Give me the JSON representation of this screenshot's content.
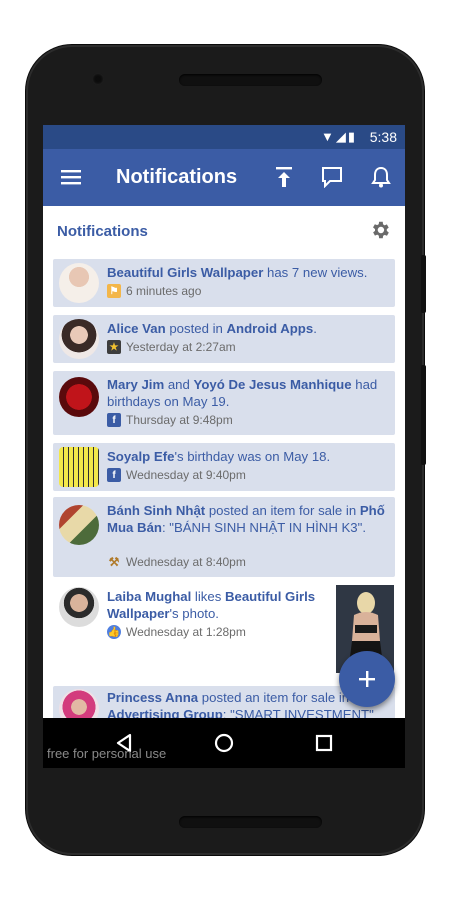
{
  "status_bar": {
    "time": "5:38",
    "wifi_icon": "wifi-icon",
    "signal_icon": "signal-icon",
    "battery_icon": "battery-icon"
  },
  "app_bar": {
    "title": "Notifications",
    "menu_icon": "hamburger-menu-icon",
    "actions": [
      "scroll-top-icon",
      "chat-icon",
      "bell-icon"
    ]
  },
  "section": {
    "title": "Notifications",
    "settings_icon": "gear-icon"
  },
  "notifications": [
    {
      "parts": [
        {
          "t": "Beautiful Girls Wallpaper",
          "b": true
        },
        {
          "t": " has 7 new views.",
          "b": false
        }
      ],
      "icon": "flag-icon",
      "time": "6 minutes ago",
      "unread": true
    },
    {
      "parts": [
        {
          "t": "Alice Van",
          "b": true
        },
        {
          "t": " posted in ",
          "b": false
        },
        {
          "t": "Android Apps",
          "b": true
        },
        {
          "t": ".",
          "b": false
        }
      ],
      "icon": "star-icon",
      "time": "Yesterday at 2:27am",
      "unread": true
    },
    {
      "parts": [
        {
          "t": "Mary Jim",
          "b": true
        },
        {
          "t": " and ",
          "b": false
        },
        {
          "t": "Yoyó De Jesus Manhique",
          "b": true
        },
        {
          "t": " had birthdays on May 19.",
          "b": false
        }
      ],
      "icon": "facebook-icon",
      "time": "Thursday at 9:48pm",
      "unread": true
    },
    {
      "parts": [
        {
          "t": "Soyalp Efe",
          "b": true
        },
        {
          "t": "'s birthday was on May 18.",
          "b": false
        }
      ],
      "icon": "facebook-icon",
      "time": "Wednesday at 9:40pm",
      "unread": true
    },
    {
      "parts": [
        {
          "t": "Bánh Sinh Nhật",
          "b": true
        },
        {
          "t": " posted an item for sale in ",
          "b": false
        },
        {
          "t": "Phố Mua Bán",
          "b": true
        },
        {
          "t": ": \"BÁNH SINH NHẬT IN HÌNH K3\".",
          "b": false
        }
      ],
      "icon": "auction-hammer-icon",
      "time": "Wednesday at 8:40pm",
      "unread": true
    },
    {
      "parts": [
        {
          "t": "Laiba Mughal",
          "b": true
        },
        {
          "t": " likes ",
          "b": false
        },
        {
          "t": "Beautiful Girls Wallpaper",
          "b": true
        },
        {
          "t": "'s photo.",
          "b": false
        }
      ],
      "icon": "like-icon",
      "time": "Wednesday at 1:28pm",
      "unread": false
    },
    {
      "parts": [
        {
          "t": "Princess Anna",
          "b": true
        },
        {
          "t": " posted an item for sale in ",
          "b": false
        },
        {
          "t": "Advertising Group",
          "b": true
        },
        {
          "t": ": \"SMART INVESTMENT\"",
          "b": false
        }
      ],
      "icon": "auction-hammer-icon",
      "time": "",
      "unread": true
    }
  ],
  "fab": {
    "icon": "plus-icon"
  },
  "nav_bar": {
    "icons": [
      "back-icon",
      "home-icon",
      "recents-icon"
    ]
  },
  "watermark": "free for personal use",
  "colors": {
    "brand": "#3b5ca5",
    "status_bar": "#2a4a86",
    "unread_bg": "#d9dfec"
  }
}
